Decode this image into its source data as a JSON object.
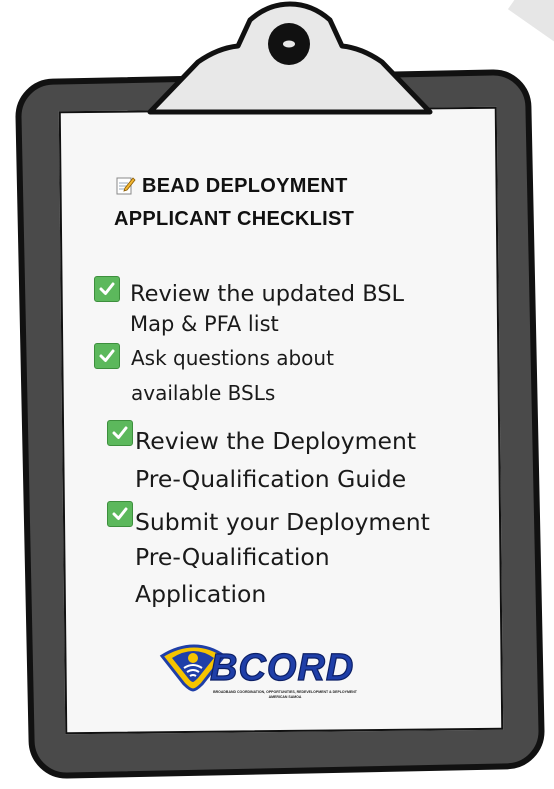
{
  "checklist": {
    "title_line1": "BEAD DEPLOYMENT",
    "title_line2": "APPLICANT CHECKLIST",
    "title_icon": "memo-icon",
    "check_color": "#5cb85c",
    "items": [
      {
        "line1": "Review the updated BSL",
        "line2": "Map & PFA list"
      },
      {
        "line1": "Ask questions about",
        "line2": "available BSLs"
      },
      {
        "line1": "Review the Deployment",
        "line2": "Pre-Qualification Guide"
      },
      {
        "line1": "Submit your Deployment",
        "line2": "Pre-Qualification",
        "line3": "Application"
      }
    ]
  },
  "logo": {
    "wordmark": "BCORD",
    "caption_line1": "BROADBAND COORDINATION, OPPORTUNITIES, REDEVELOPMENT & DEPLOYMENT",
    "caption_line2": "AMERICAN SAMOA",
    "colors": {
      "blue": "#1f3fa8",
      "yellow": "#f5c400"
    }
  },
  "clipboard": {
    "board_color": "#4a4a4a",
    "clip_color": "#e8e8e8"
  }
}
